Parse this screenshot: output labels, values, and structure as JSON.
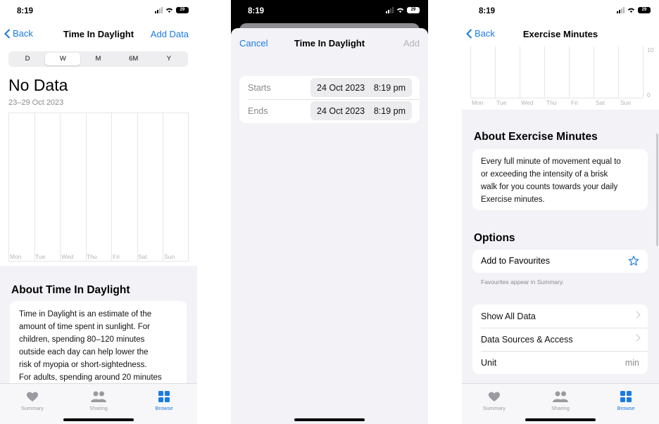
{
  "p1": {
    "time": "8:19",
    "battery": "29",
    "back": "Back",
    "title": "Time In Daylight",
    "right": "Add Data",
    "seg": [
      "D",
      "W",
      "M",
      "6M",
      "Y"
    ],
    "big": "No Data",
    "range": "23–29 Oct 2023",
    "days": [
      "Mon",
      "Tue",
      "Wed",
      "Thu",
      "Fri",
      "Sat",
      "Sun"
    ],
    "about_title": "About Time In Daylight",
    "about_lines": [
      "Time in Daylight is an estimate of the",
      "amount of time spent in sunlight. For",
      "children, spending 80–120 minutes",
      "outside each day can help lower the",
      "risk of myopia or short-sightedness.",
      "For adults, spending around 20 minutes"
    ],
    "tabs": [
      "Summary",
      "Sharing",
      "Browse"
    ]
  },
  "p2": {
    "time": "8:19",
    "battery": "29",
    "cancel": "Cancel",
    "title": "Time In Daylight",
    "add": "Add",
    "starts_label": "Starts",
    "starts_date": "24 Oct 2023",
    "starts_time": "8:19 pm",
    "ends_label": "Ends",
    "ends_date": "24 Oct 2023",
    "ends_time": "8:19 pm"
  },
  "p3": {
    "time": "8:19",
    "battery": "29",
    "back": "Back",
    "title": "Exercise Minutes",
    "ytick_top": "10",
    "ytick_bottom": "0",
    "days": [
      "Mon",
      "Tue",
      "Wed",
      "Thu",
      "Fri",
      "Sat",
      "Sun"
    ],
    "about_title": "About Exercise Minutes",
    "about_lines": [
      "Every full minute of movement equal to",
      "or exceeding the intensity of a brisk",
      "walk for you counts towards your daily",
      "Exercise minutes."
    ],
    "options_title": "Options",
    "fav_label": "Add to Favourites",
    "fav_note": "Favourites appear in Summary.",
    "show_all": "Show All Data",
    "sources": "Data Sources & Access",
    "unit_label": "Unit",
    "unit_value": "min",
    "tabs": [
      "Summary",
      "Sharing",
      "Browse"
    ]
  },
  "colors": {
    "accent": "#1a7ae4",
    "bg_grouped": "#f2f2f7"
  }
}
